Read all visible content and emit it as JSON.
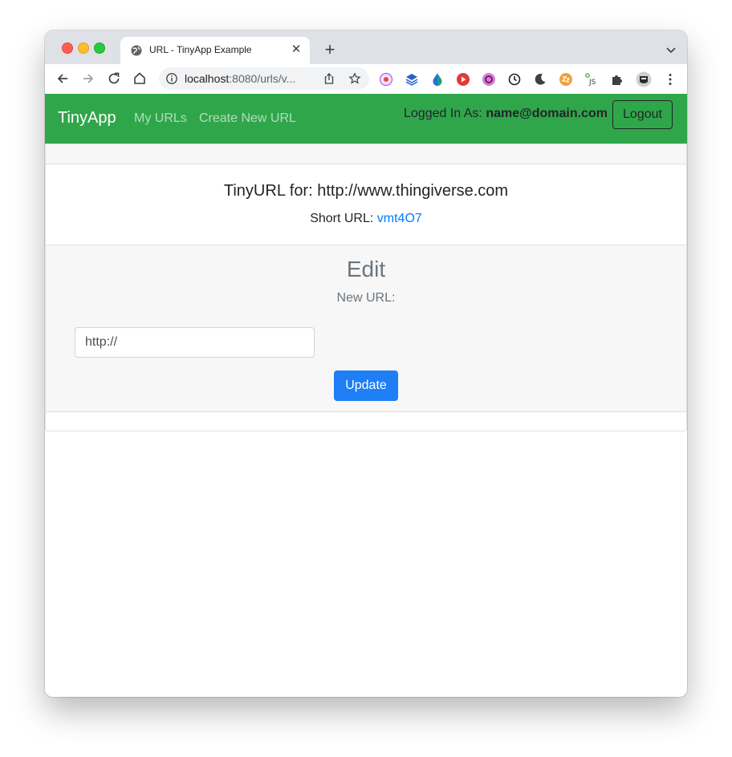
{
  "browser": {
    "tab_title": "URL - TinyApp Example",
    "new_tab_symbol": "+",
    "close_tab_symbol": "✕",
    "url_host": "localhost",
    "url_rest": ":8080/urls/v..."
  },
  "navbar": {
    "brand": "TinyApp",
    "links": [
      "My URLs",
      "Create New URL"
    ],
    "logged_in_prefix": "Logged In As:",
    "user_email": "name@domain.com",
    "logout_label": "Logout"
  },
  "url_card": {
    "title": "TinyURL for: http://www.thingiverse.com",
    "short_url_label": "Short URL:",
    "short_url_value": "vmt4O7"
  },
  "edit": {
    "heading": "Edit",
    "new_url_label": "New URL:",
    "input_placeholder": "http://",
    "update_label": "Update"
  },
  "colors": {
    "navbar": "#30a64a",
    "primary_button": "#1e7ef5",
    "link": "#007bff"
  },
  "icons": {
    "tab_favicon": "globe-icon",
    "extensions": [
      "extension-a-icon",
      "layers-icon",
      "drop-icon",
      "play-icon",
      "circle-icon",
      "clock-icon",
      "moon-icon",
      "zz-icon",
      "js-icon",
      "puzzle-icon",
      "profile-avatar-icon",
      "more-icon"
    ]
  }
}
